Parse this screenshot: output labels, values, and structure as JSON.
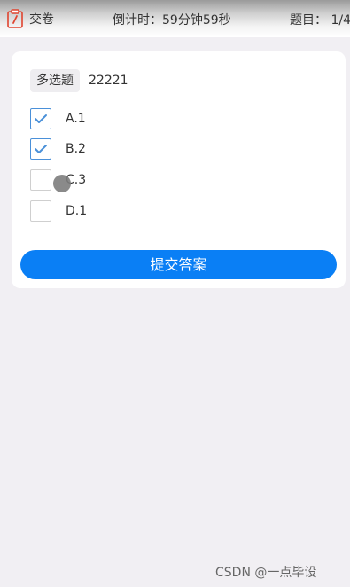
{
  "header": {
    "submit_label": "交卷",
    "submit_icon": "clipboard-icon",
    "countdown": "倒计时：59分钟59秒",
    "progress": "题目： 1/4"
  },
  "question": {
    "type_badge": "多选题",
    "title": "22221",
    "options": [
      {
        "label": "A.1",
        "checked": true
      },
      {
        "label": "B.2",
        "checked": true
      },
      {
        "label": "C.3",
        "checked": false
      },
      {
        "label": "D.1",
        "checked": false
      }
    ]
  },
  "submit_answer_label": "提交答案",
  "watermark": "CSDN @一点毕设",
  "colors": {
    "accent": "#0a7ff5",
    "check": "#4a90d9",
    "background": "#f1eff3",
    "icon_red": "#e0442f"
  }
}
